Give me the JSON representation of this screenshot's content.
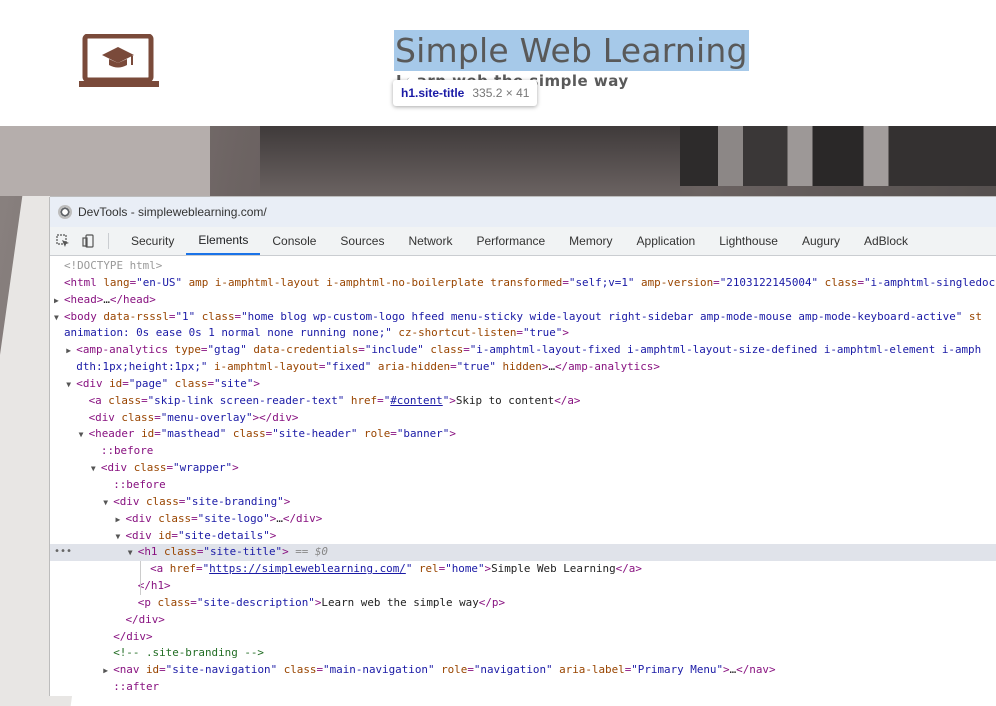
{
  "site": {
    "title": "Simple Web Learning",
    "description": "Learn web the simple way",
    "tooltip_tag": "h1.site-title",
    "tooltip_size": "335.2 × 41",
    "logo_icon": "laptop-graduation-cap-icon",
    "brand_color": "#7a4a3a"
  },
  "devtools": {
    "window_title": "DevTools - simpleweblearning.com/",
    "tabs": [
      {
        "label": "Security",
        "active": false
      },
      {
        "label": "Elements",
        "active": true
      },
      {
        "label": "Console",
        "active": false
      },
      {
        "label": "Sources",
        "active": false
      },
      {
        "label": "Network",
        "active": false
      },
      {
        "label": "Performance",
        "active": false
      },
      {
        "label": "Memory",
        "active": false
      },
      {
        "label": "Application",
        "active": false
      },
      {
        "label": "Lighthouse",
        "active": false
      },
      {
        "label": "Augury",
        "active": false
      },
      {
        "label": "AdBlock",
        "active": false
      }
    ],
    "dom_lines": [
      {
        "indent": 0,
        "toggle": "",
        "parts": [
          {
            "t": "doctype",
            "v": "<!DOCTYPE html>"
          }
        ]
      },
      {
        "indent": 0,
        "toggle": "",
        "parts": [
          {
            "t": "tag",
            "v": "<html "
          },
          {
            "t": "attr",
            "v": "lang"
          },
          {
            "t": "tag",
            "v": "="
          },
          {
            "t": "val",
            "v": "\"en-US\""
          },
          {
            "t": "attr",
            "v": " amp i-amphtml-layout i-amphtml-no-boilerplate transformed"
          },
          {
            "t": "tag",
            "v": "="
          },
          {
            "t": "val",
            "v": "\"self;v=1\""
          },
          {
            "t": "attr",
            "v": " amp-version"
          },
          {
            "t": "tag",
            "v": "="
          },
          {
            "t": "val",
            "v": "\"2103122145004\""
          },
          {
            "t": "attr",
            "v": " class"
          },
          {
            "t": "tag",
            "v": "="
          },
          {
            "t": "val",
            "v": "\"i-amphtml-singledoc"
          }
        ]
      },
      {
        "indent": 0,
        "toggle": "▶",
        "parts": [
          {
            "t": "tag",
            "v": "<head>"
          },
          {
            "t": "text",
            "v": "…"
          },
          {
            "t": "tag",
            "v": "</head>"
          }
        ]
      },
      {
        "indent": 0,
        "toggle": "▼",
        "parts": [
          {
            "t": "tag",
            "v": "<body "
          },
          {
            "t": "attr",
            "v": "data-rsssl"
          },
          {
            "t": "tag",
            "v": "="
          },
          {
            "t": "val",
            "v": "\"1\""
          },
          {
            "t": "attr",
            "v": " class"
          },
          {
            "t": "tag",
            "v": "="
          },
          {
            "t": "val",
            "v": "\"home blog wp-custom-logo hfeed menu-sticky wide-layout right-sidebar amp-mode-mouse amp-mode-keyboard-active\""
          },
          {
            "t": "attr",
            "v": " st"
          }
        ]
      },
      {
        "indent": 0,
        "toggle": "",
        "parts": [
          {
            "t": "val",
            "v": "animation: 0s ease 0s 1 normal none running none;\""
          },
          {
            "t": "attr",
            "v": " cz-shortcut-listen"
          },
          {
            "t": "tag",
            "v": "="
          },
          {
            "t": "val",
            "v": "\"true\""
          },
          {
            "t": "tag",
            "v": ">"
          }
        ]
      },
      {
        "indent": 1,
        "toggle": "▶",
        "parts": [
          {
            "t": "tag",
            "v": "<amp-analytics "
          },
          {
            "t": "attr",
            "v": "type"
          },
          {
            "t": "tag",
            "v": "="
          },
          {
            "t": "val",
            "v": "\"gtag\""
          },
          {
            "t": "attr",
            "v": " data-credentials"
          },
          {
            "t": "tag",
            "v": "="
          },
          {
            "t": "val",
            "v": "\"include\""
          },
          {
            "t": "attr",
            "v": " class"
          },
          {
            "t": "tag",
            "v": "="
          },
          {
            "t": "val",
            "v": "\"i-amphtml-layout-fixed i-amphtml-layout-size-defined i-amphtml-element i-amph"
          }
        ]
      },
      {
        "indent": 1,
        "toggle": "",
        "parts": [
          {
            "t": "val",
            "v": "dth:1px;height:1px;\""
          },
          {
            "t": "attr",
            "v": " i-amphtml-layout"
          },
          {
            "t": "tag",
            "v": "="
          },
          {
            "t": "val",
            "v": "\"fixed\""
          },
          {
            "t": "attr",
            "v": " aria-hidden"
          },
          {
            "t": "tag",
            "v": "="
          },
          {
            "t": "val",
            "v": "\"true\""
          },
          {
            "t": "attr",
            "v": " hidden"
          },
          {
            "t": "tag",
            "v": ">"
          },
          {
            "t": "text",
            "v": "…"
          },
          {
            "t": "tag",
            "v": "</amp-analytics>"
          }
        ]
      },
      {
        "indent": 1,
        "toggle": "▼",
        "parts": [
          {
            "t": "tag",
            "v": "<div "
          },
          {
            "t": "attr",
            "v": "id"
          },
          {
            "t": "tag",
            "v": "="
          },
          {
            "t": "val",
            "v": "\"page\""
          },
          {
            "t": "attr",
            "v": " class"
          },
          {
            "t": "tag",
            "v": "="
          },
          {
            "t": "val",
            "v": "\"site\""
          },
          {
            "t": "tag",
            "v": ">"
          }
        ]
      },
      {
        "indent": 2,
        "toggle": "",
        "parts": [
          {
            "t": "tag",
            "v": "<a "
          },
          {
            "t": "attr",
            "v": "class"
          },
          {
            "t": "tag",
            "v": "="
          },
          {
            "t": "val",
            "v": "\"skip-link screen-reader-text\""
          },
          {
            "t": "attr",
            "v": " href"
          },
          {
            "t": "tag",
            "v": "="
          },
          {
            "t": "val",
            "v": "\""
          },
          {
            "t": "link",
            "v": "#content"
          },
          {
            "t": "val",
            "v": "\""
          },
          {
            "t": "tag",
            "v": ">"
          },
          {
            "t": "text",
            "v": "Skip to content"
          },
          {
            "t": "tag",
            "v": "</a>"
          }
        ]
      },
      {
        "indent": 2,
        "toggle": "",
        "parts": [
          {
            "t": "tag",
            "v": "<div "
          },
          {
            "t": "attr",
            "v": "class"
          },
          {
            "t": "tag",
            "v": "="
          },
          {
            "t": "val",
            "v": "\"menu-overlay\""
          },
          {
            "t": "tag",
            "v": "></div>"
          }
        ]
      },
      {
        "indent": 2,
        "toggle": "▼",
        "parts": [
          {
            "t": "tag",
            "v": "<header "
          },
          {
            "t": "attr",
            "v": "id"
          },
          {
            "t": "tag",
            "v": "="
          },
          {
            "t": "val",
            "v": "\"masthead\""
          },
          {
            "t": "attr",
            "v": " class"
          },
          {
            "t": "tag",
            "v": "="
          },
          {
            "t": "val",
            "v": "\"site-header\""
          },
          {
            "t": "attr",
            "v": " role"
          },
          {
            "t": "tag",
            "v": "="
          },
          {
            "t": "val",
            "v": "\"banner\""
          },
          {
            "t": "tag",
            "v": ">"
          }
        ]
      },
      {
        "indent": 3,
        "toggle": "",
        "parts": [
          {
            "t": "pseudo",
            "v": "::before"
          }
        ]
      },
      {
        "indent": 3,
        "toggle": "▼",
        "parts": [
          {
            "t": "tag",
            "v": "<div "
          },
          {
            "t": "attr",
            "v": "class"
          },
          {
            "t": "tag",
            "v": "="
          },
          {
            "t": "val",
            "v": "\"wrapper\""
          },
          {
            "t": "tag",
            "v": ">"
          }
        ]
      },
      {
        "indent": 4,
        "toggle": "",
        "parts": [
          {
            "t": "pseudo",
            "v": "::before"
          }
        ]
      },
      {
        "indent": 4,
        "toggle": "▼",
        "parts": [
          {
            "t": "tag",
            "v": "<div "
          },
          {
            "t": "attr",
            "v": "class"
          },
          {
            "t": "tag",
            "v": "="
          },
          {
            "t": "val",
            "v": "\"site-branding\""
          },
          {
            "t": "tag",
            "v": ">"
          }
        ]
      },
      {
        "indent": 5,
        "toggle": "▶",
        "parts": [
          {
            "t": "tag",
            "v": "<div "
          },
          {
            "t": "attr",
            "v": "class"
          },
          {
            "t": "tag",
            "v": "="
          },
          {
            "t": "val",
            "v": "\"site-logo\""
          },
          {
            "t": "tag",
            "v": ">"
          },
          {
            "t": "text",
            "v": "…"
          },
          {
            "t": "tag",
            "v": "</div>"
          }
        ]
      },
      {
        "indent": 5,
        "toggle": "▼",
        "parts": [
          {
            "t": "tag",
            "v": "<div "
          },
          {
            "t": "attr",
            "v": "id"
          },
          {
            "t": "tag",
            "v": "="
          },
          {
            "t": "val",
            "v": "\"site-details\""
          },
          {
            "t": "tag",
            "v": ">"
          }
        ]
      },
      {
        "indent": 6,
        "toggle": "▼",
        "selected": true,
        "parts": [
          {
            "t": "tag",
            "v": "<h1 "
          },
          {
            "t": "attr",
            "v": "class"
          },
          {
            "t": "tag",
            "v": "="
          },
          {
            "t": "val",
            "v": "\"site-title\""
          },
          {
            "t": "tag",
            "v": ">"
          },
          {
            "t": "eq",
            "v": " == $0"
          }
        ]
      },
      {
        "indent": 7,
        "toggle": "",
        "parts": [
          {
            "t": "tag",
            "v": "<a "
          },
          {
            "t": "attr",
            "v": "href"
          },
          {
            "t": "tag",
            "v": "="
          },
          {
            "t": "val",
            "v": "\""
          },
          {
            "t": "link",
            "v": "https://simpleweblearning.com/"
          },
          {
            "t": "val",
            "v": "\""
          },
          {
            "t": "attr",
            "v": " rel"
          },
          {
            "t": "tag",
            "v": "="
          },
          {
            "t": "val",
            "v": "\"home\""
          },
          {
            "t": "tag",
            "v": ">"
          },
          {
            "t": "text",
            "v": "Simple Web Learning"
          },
          {
            "t": "tag",
            "v": "</a>"
          }
        ]
      },
      {
        "indent": 6,
        "toggle": "",
        "parts": [
          {
            "t": "tag",
            "v": "</h1>"
          }
        ]
      },
      {
        "indent": 6,
        "toggle": "",
        "parts": [
          {
            "t": "tag",
            "v": "<p "
          },
          {
            "t": "attr",
            "v": "class"
          },
          {
            "t": "tag",
            "v": "="
          },
          {
            "t": "val",
            "v": "\"site-description\""
          },
          {
            "t": "tag",
            "v": ">"
          },
          {
            "t": "text",
            "v": "Learn web the simple way"
          },
          {
            "t": "tag",
            "v": "</p>"
          }
        ]
      },
      {
        "indent": 5,
        "toggle": "",
        "parts": [
          {
            "t": "tag",
            "v": "</div>"
          }
        ]
      },
      {
        "indent": 4,
        "toggle": "",
        "parts": [
          {
            "t": "tag",
            "v": "</div>"
          }
        ]
      },
      {
        "indent": 4,
        "toggle": "",
        "parts": [
          {
            "t": "cm",
            "v": "<!-- .site-branding -->"
          }
        ]
      },
      {
        "indent": 4,
        "toggle": "▶",
        "parts": [
          {
            "t": "tag",
            "v": "<nav "
          },
          {
            "t": "attr",
            "v": "id"
          },
          {
            "t": "tag",
            "v": "="
          },
          {
            "t": "val",
            "v": "\"site-navigation\""
          },
          {
            "t": "attr",
            "v": " class"
          },
          {
            "t": "tag",
            "v": "="
          },
          {
            "t": "val",
            "v": "\"main-navigation\""
          },
          {
            "t": "attr",
            "v": " role"
          },
          {
            "t": "tag",
            "v": "="
          },
          {
            "t": "val",
            "v": "\"navigation\""
          },
          {
            "t": "attr",
            "v": " aria-label"
          },
          {
            "t": "tag",
            "v": "="
          },
          {
            "t": "val",
            "v": "\"Primary Menu\""
          },
          {
            "t": "tag",
            "v": ">"
          },
          {
            "t": "text",
            "v": "…"
          },
          {
            "t": "tag",
            "v": "</nav>"
          }
        ]
      },
      {
        "indent": 4,
        "toggle": "",
        "parts": [
          {
            "t": "pseudo",
            "v": "::after"
          }
        ]
      }
    ]
  }
}
